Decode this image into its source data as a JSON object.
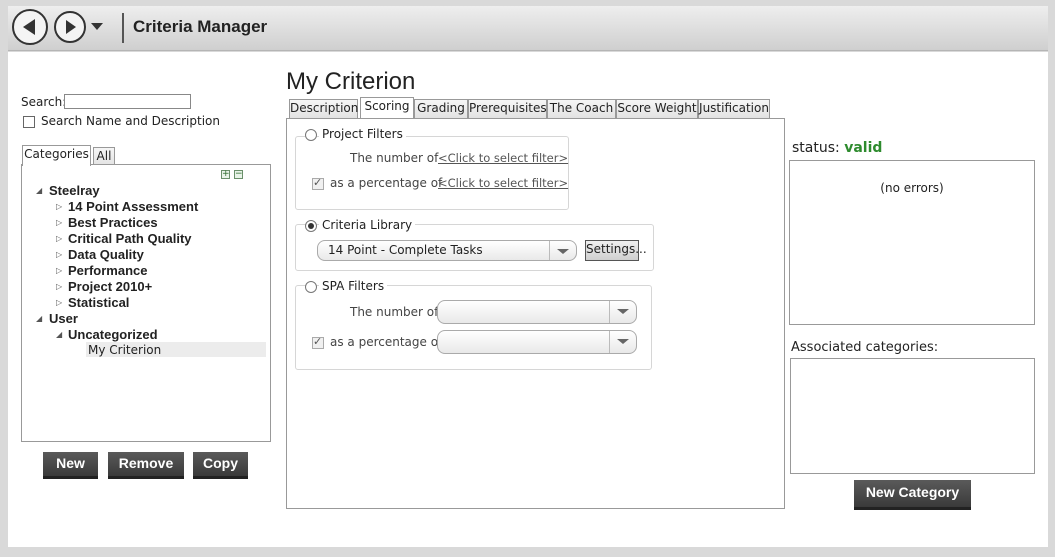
{
  "window": {
    "title": "Criteria Manager"
  },
  "nav": {
    "back_icon": "back-arrow-icon",
    "forward_icon": "forward-arrow-icon",
    "dropdown_icon": "chevron-down-icon"
  },
  "left": {
    "search_label": "Search:",
    "search_value": "",
    "search_name_desc_label": "Search Name and Description",
    "tabs": [
      {
        "label": "Categories"
      },
      {
        "label": "All"
      }
    ],
    "tree": [
      {
        "label": "Steelray",
        "level": 0,
        "expanded": true
      },
      {
        "label": "14 Point Assessment",
        "level": 1,
        "expanded": false
      },
      {
        "label": "Best Practices",
        "level": 1,
        "expanded": false
      },
      {
        "label": "Critical Path Quality",
        "level": 1,
        "expanded": false
      },
      {
        "label": "Data Quality",
        "level": 1,
        "expanded": false
      },
      {
        "label": "Performance",
        "level": 1,
        "expanded": false
      },
      {
        "label": "Project 2010+",
        "level": 1,
        "expanded": false
      },
      {
        "label": "Statistical",
        "level": 1,
        "expanded": false
      },
      {
        "label": "User",
        "level": 0,
        "expanded": true
      },
      {
        "label": "Uncategorized",
        "level": 1,
        "expanded": true
      },
      {
        "label": "My Criterion",
        "level": 2,
        "selected": true
      }
    ],
    "buttons": {
      "new": "New",
      "remove": "Remove",
      "copy": "Copy"
    }
  },
  "center": {
    "criterion_title": "My Criterion",
    "tabs": [
      {
        "label": "Description"
      },
      {
        "label": "Scoring",
        "active": true
      },
      {
        "label": "Grading"
      },
      {
        "label": "Prerequisites"
      },
      {
        "label": "The Coach"
      },
      {
        "label": "Score Weight"
      },
      {
        "label": "Justification"
      }
    ],
    "project_filters": {
      "title": "Project Filters",
      "number_of_label": "The number of",
      "number_of_link": "<Click to select filter>",
      "percentage_label": "as a percentage of",
      "percentage_link": "<Click to select filter>"
    },
    "criteria_library": {
      "title": "Criteria Library",
      "selected": "14 Point - Complete Tasks",
      "settings_label": "Settings..."
    },
    "spa_filters": {
      "title": "SPA Filters",
      "number_of_label": "The number of",
      "number_of_value": "",
      "percentage_label": "as a percentage of",
      "percentage_value": ""
    }
  },
  "right": {
    "status_label": "status:",
    "status_value": "valid",
    "status_color": "#2e8b2e",
    "errors_text": "(no errors)",
    "associated_label": "Associated categories:",
    "new_category_label": "New Category"
  }
}
